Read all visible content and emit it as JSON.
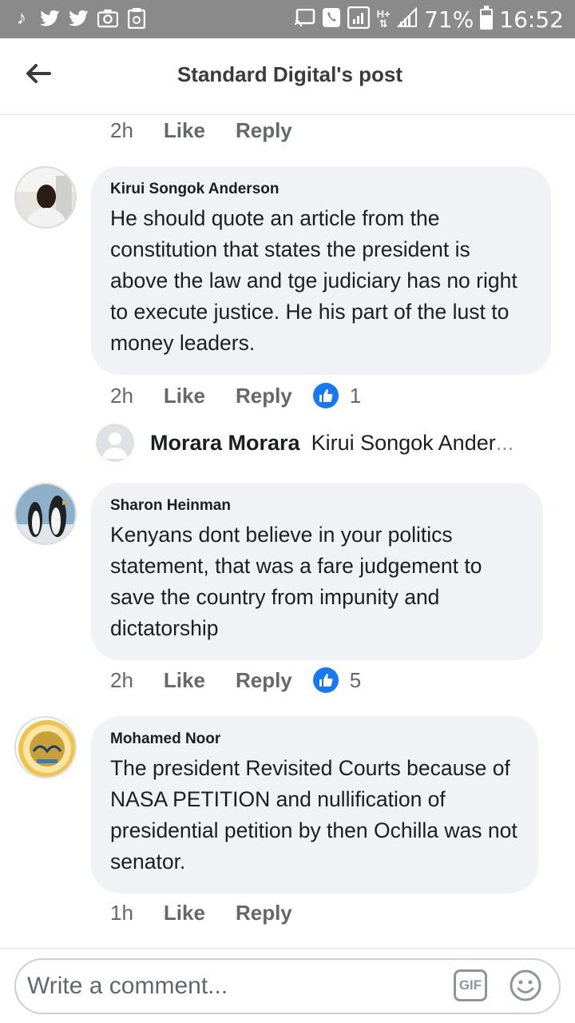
{
  "status_bar": {
    "icons": [
      "tiktok-icon",
      "twitter-icon",
      "twitter-icon",
      "camera-icon",
      "clipboard-icon"
    ],
    "right_icons": [
      "cast-icon",
      "phone-icon",
      "signal-icon",
      "hplus-icon",
      "signal-icon"
    ],
    "battery": "71%",
    "time": "16:52"
  },
  "header": {
    "title": "Standard Digital's post"
  },
  "top_actions": {
    "time": "2h",
    "like": "Like",
    "reply": "Reply"
  },
  "comments": [
    {
      "author": "Kirui Songok Anderson",
      "text": "He should quote an article from the constitution that states the president is above the law and tge judiciary has no right to execute justice. He his part of the lust to money leaders.",
      "time": "2h",
      "like": "Like",
      "reply": "Reply",
      "reactions": "1"
    },
    {
      "author": "Sharon Heinman",
      "text": "Kenyans dont believe  in your politics statement, that was a fare judgement  to save the country  from impunity  and dictatorship",
      "time": "2h",
      "like": "Like",
      "reply": "Reply",
      "reactions": "5"
    },
    {
      "author": "Mohamed Noor",
      "text": "The president Revisited Courts because of NASA PETITION and nullification of presidential petition by then Ochilla was not senator.",
      "time": "1h",
      "like": "Like",
      "reply": "Reply"
    }
  ],
  "reply_preview": {
    "author": "Morara Morara",
    "text": "Kirui Songok Ander",
    "ellipsis": "..."
  },
  "composer": {
    "placeholder": "Write a comment...",
    "gif_label": "GIF"
  },
  "colors": {
    "status_bar": "#8a8a8a",
    "bubble": "#f0f2f5",
    "like_blue": "#1877f2",
    "meta_text": "#65676b"
  }
}
